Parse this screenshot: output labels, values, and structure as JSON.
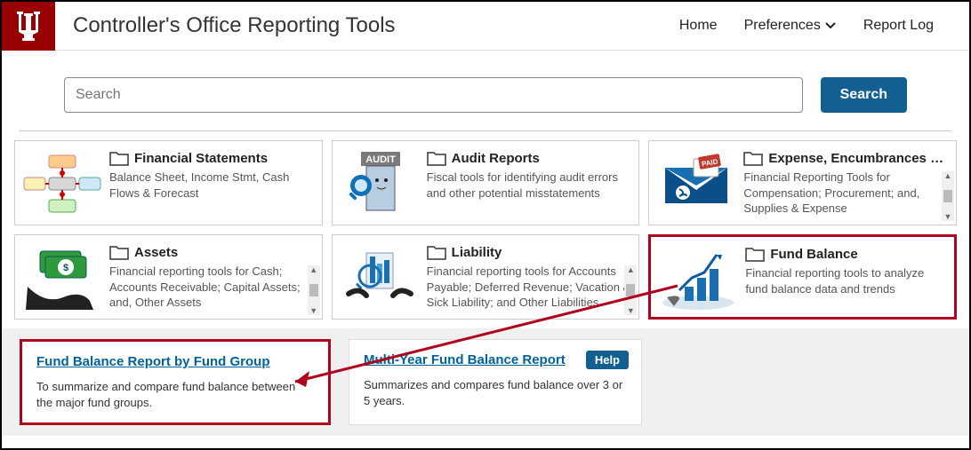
{
  "header": {
    "title": "Controller's Office Reporting Tools",
    "nav": {
      "home": "Home",
      "prefs": "Preferences",
      "log": "Report Log"
    }
  },
  "search": {
    "placeholder": "Search",
    "button": "Search"
  },
  "cards": [
    {
      "title": "Financial Statements",
      "desc": "Balance Sheet, Income Stmt, Cash Flows & Forecast"
    },
    {
      "title": "Audit Reports",
      "desc": "Fiscal tools for identifying audit errors and other potential misstatements"
    },
    {
      "title": "Expense, Encumbrances & ...",
      "desc": "Financial Reporting Tools for Compensation; Procurement; and, Supplies & Expense"
    },
    {
      "title": "Assets",
      "desc": "Financial reporting tools for Cash; Accounts Receivable; Capital Assets; and, Other Assets"
    },
    {
      "title": "Liability",
      "desc": "Financial reporting tools for Accounts Payable; Deferred Revenue; Vacation & Sick Liability; and Other Liabilities"
    },
    {
      "title": "Fund Balance",
      "desc": "Financial reporting tools to analyze fund balance data and trends"
    }
  ],
  "reports": [
    {
      "title": "Fund Balance Report by Fund Group",
      "desc": "To summarize and compare fund balance between the major fund groups."
    },
    {
      "title": "Multi-Year Fund Balance Report",
      "desc": "Summarizes and compares fund balance over 3 or 5 years.",
      "help": "Help"
    }
  ]
}
